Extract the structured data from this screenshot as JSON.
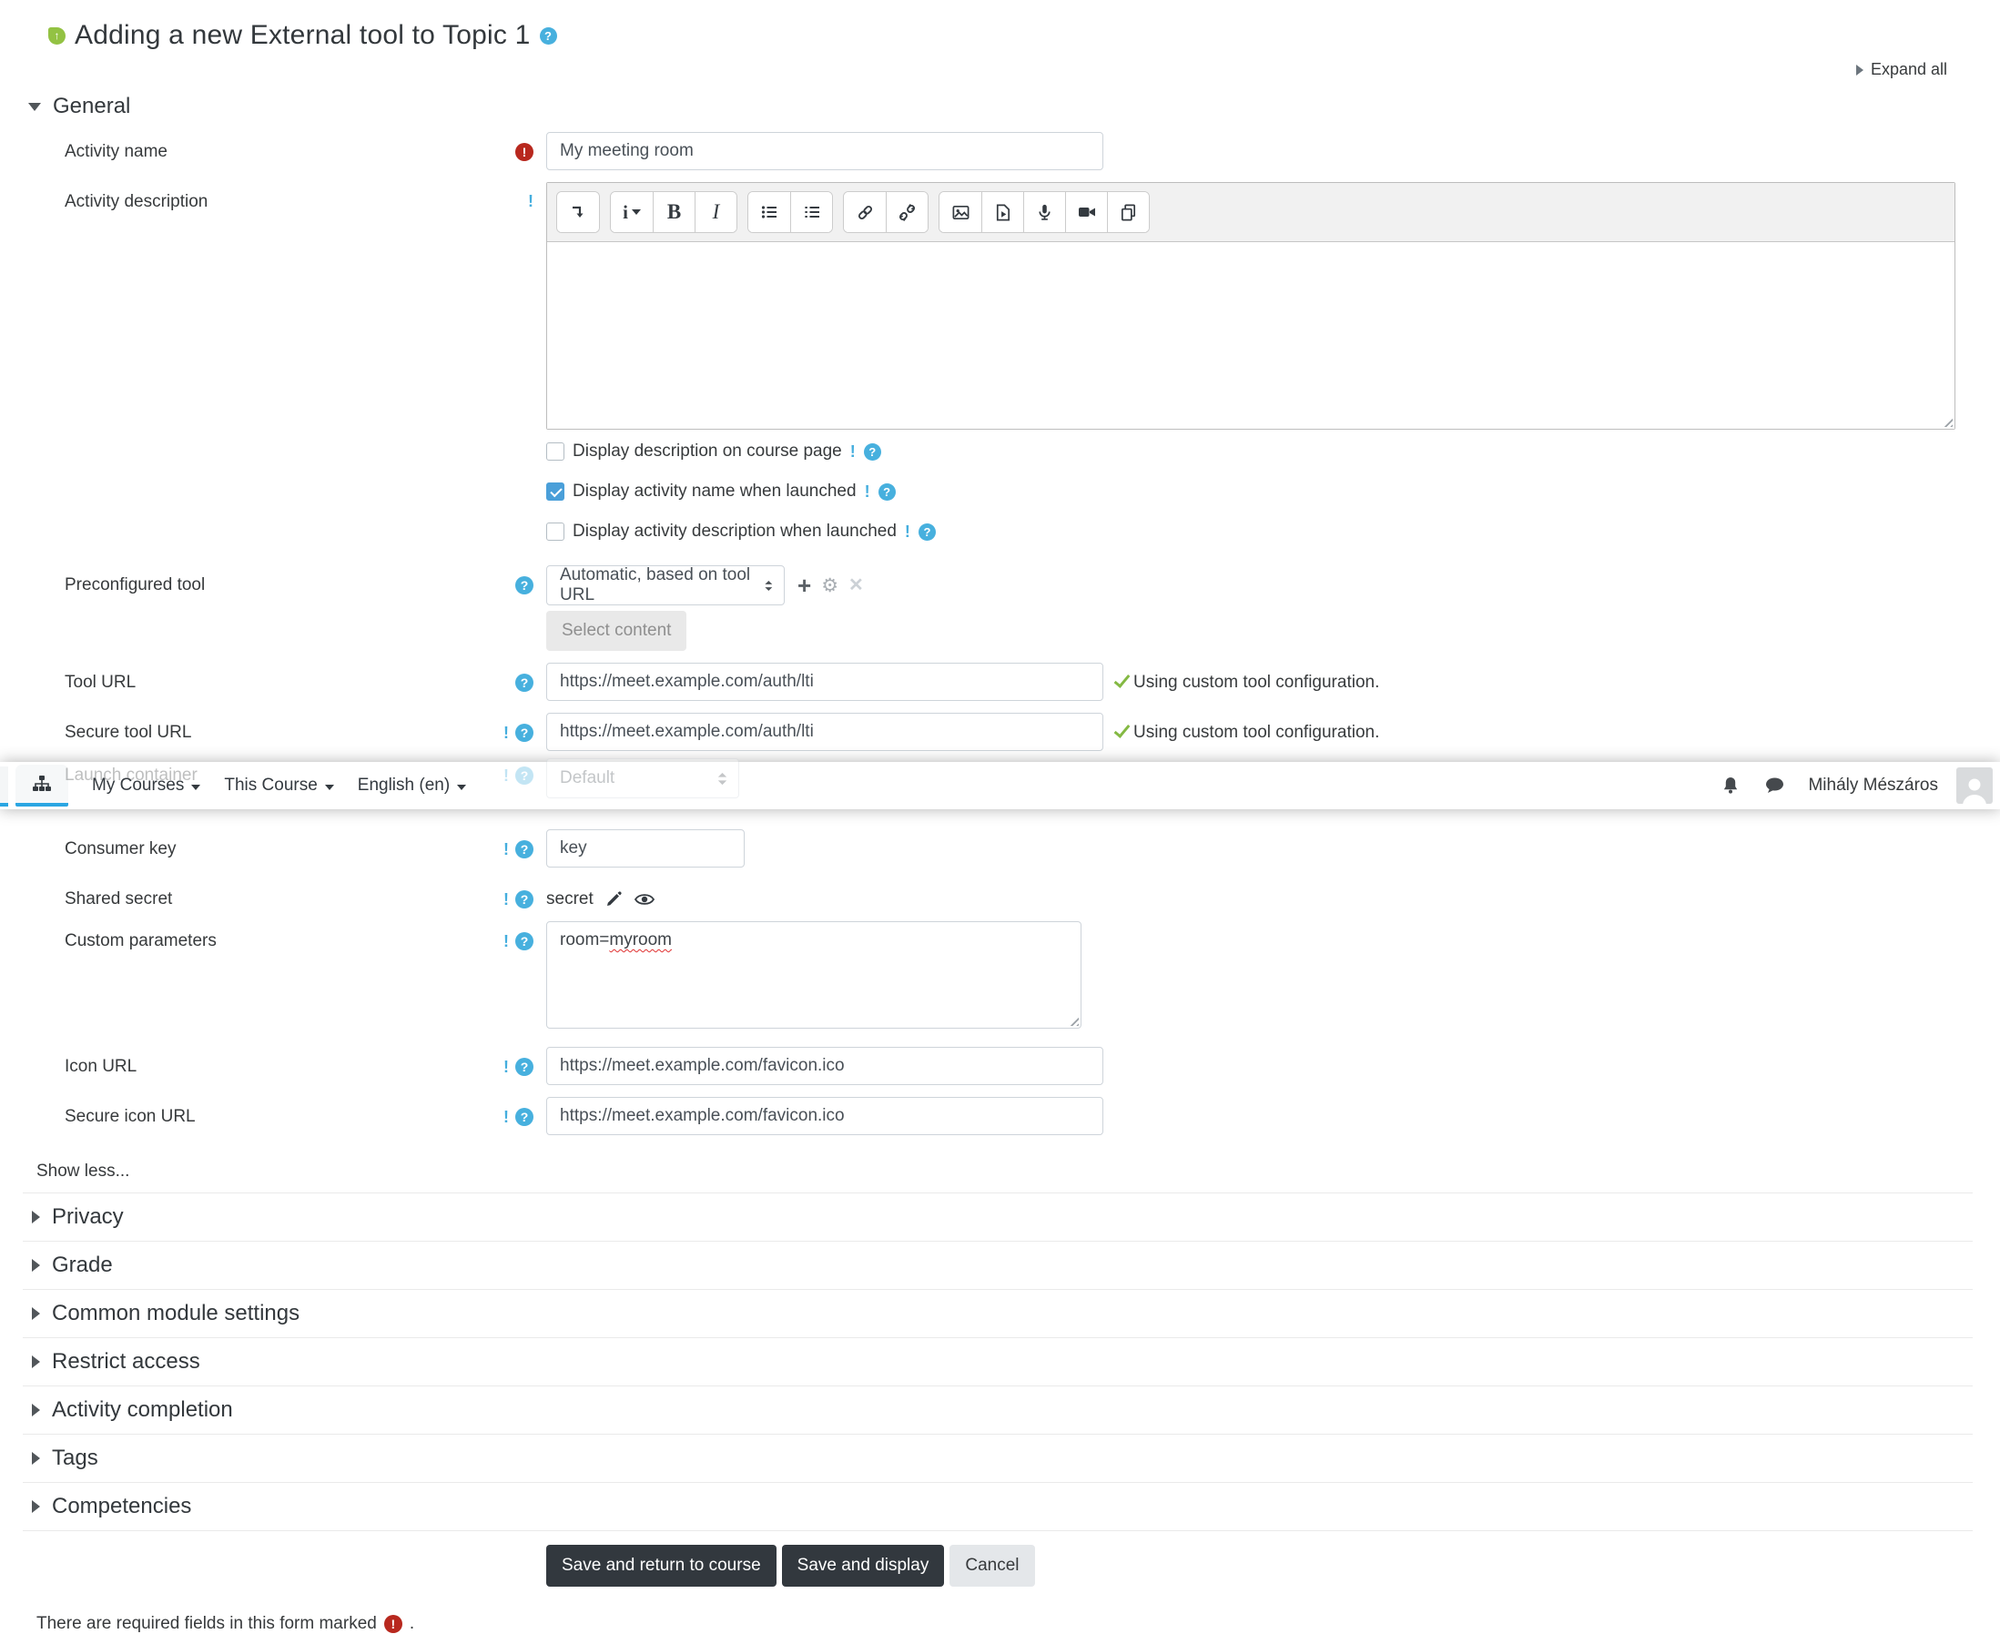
{
  "page": {
    "title": "Adding a new External tool to Topic 1",
    "expand_all": "Expand all"
  },
  "navbar": {
    "menus": [
      "My Courses",
      "This Course",
      "English (en)"
    ],
    "user_name": "Mihály Mészáros",
    "icons": [
      "sitemap-icon",
      "bell-icon",
      "messages-icon",
      "avatar"
    ]
  },
  "editor": {
    "format_label": "i",
    "bold_label": "B",
    "italic_label": "I",
    "icons": [
      "collapse-arrow-icon",
      "unordered-list-icon",
      "ordered-list-icon",
      "link-icon",
      "unlink-icon",
      "image-icon",
      "media-icon",
      "record-audio-icon",
      "record-video-icon",
      "manage-files-icon"
    ]
  },
  "general": {
    "heading": "General",
    "activity_name": {
      "label": "Activity name",
      "value": "My meeting room"
    },
    "activity_description": {
      "label": "Activity description"
    },
    "checkboxes": [
      {
        "label": "Display description on course page",
        "checked": false
      },
      {
        "label": "Display activity name when launched",
        "checked": true
      },
      {
        "label": "Display activity description when launched",
        "checked": false
      }
    ],
    "preconfigured_tool": {
      "label": "Preconfigured tool",
      "value": "Automatic, based on tool URL",
      "select_content_label": "Select content"
    },
    "tool_url": {
      "label": "Tool URL",
      "value": "https://meet.example.com/auth/lti",
      "status": "Using custom tool configuration."
    },
    "secure_tool_url": {
      "label": "Secure tool URL",
      "value": "https://meet.example.com/auth/lti",
      "status": "Using custom tool configuration."
    },
    "launch_container": {
      "label": "Launch container",
      "value": "Default"
    },
    "consumer_key": {
      "label": "Consumer key",
      "value": "key"
    },
    "shared_secret": {
      "label": "Shared secret",
      "value": "secret"
    },
    "custom_parameters": {
      "label": "Custom parameters",
      "value_prefix": "room=",
      "value_misspelled": "myroom"
    },
    "icon_url": {
      "label": "Icon URL",
      "value": "https://meet.example.com/favicon.ico"
    },
    "secure_icon_url": {
      "label": "Secure icon URL",
      "value": "https://meet.example.com/favicon.ico"
    },
    "show_less": "Show less..."
  },
  "sections": [
    "Privacy",
    "Grade",
    "Common module settings",
    "Restrict access",
    "Activity completion",
    "Tags",
    "Competencies"
  ],
  "buttons": {
    "save_return": "Save and return to course",
    "save_display": "Save and display",
    "cancel": "Cancel"
  },
  "footer": {
    "note_prefix": "There are required fields in this form marked",
    "note_suffix": "."
  },
  "colors": {
    "help_blue": "#47b0de",
    "required_red": "#b8281e",
    "success_green": "#84b943",
    "checkbox_blue": "#4a9fd9",
    "nav_active_blue": "#2ba6e2",
    "button_dark": "#32383e",
    "module_icon_green": "#93c243"
  }
}
